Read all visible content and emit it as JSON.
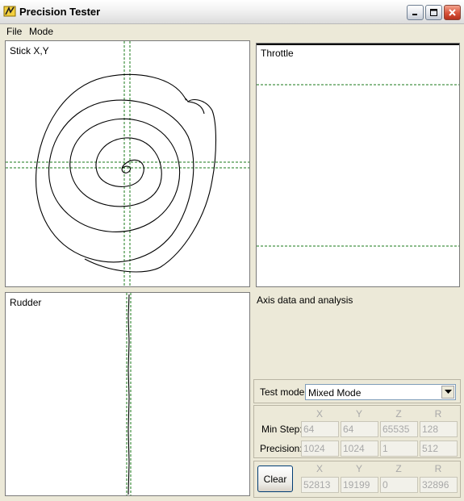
{
  "window": {
    "title": "Precision Tester"
  },
  "menu": {
    "items": [
      "File",
      "Mode"
    ]
  },
  "panels": {
    "stick": {
      "label": "Stick X,Y"
    },
    "throttle": {
      "label": "Throttle"
    },
    "rudder": {
      "label": "Rudder"
    },
    "analysis": {
      "label": "Axis data and analysis"
    }
  },
  "test_mode": {
    "label": "Test mode:",
    "value": "Mixed Mode"
  },
  "columns": [
    "X",
    "Y",
    "Z",
    "R"
  ],
  "min_step": {
    "label": "Min Step:",
    "values": [
      "64",
      "64",
      "65535",
      "128"
    ]
  },
  "precision": {
    "label": "Precision:",
    "values": [
      "1024",
      "1024",
      "1",
      "512"
    ]
  },
  "current": {
    "button": "Clear",
    "values": [
      "52813",
      "19199",
      "0",
      "32896"
    ]
  },
  "colors": {
    "guide_line": "#1a7a1a",
    "trace": "#000000",
    "panel_bg": "#ffffff",
    "window_bg": "#ece9d8"
  }
}
